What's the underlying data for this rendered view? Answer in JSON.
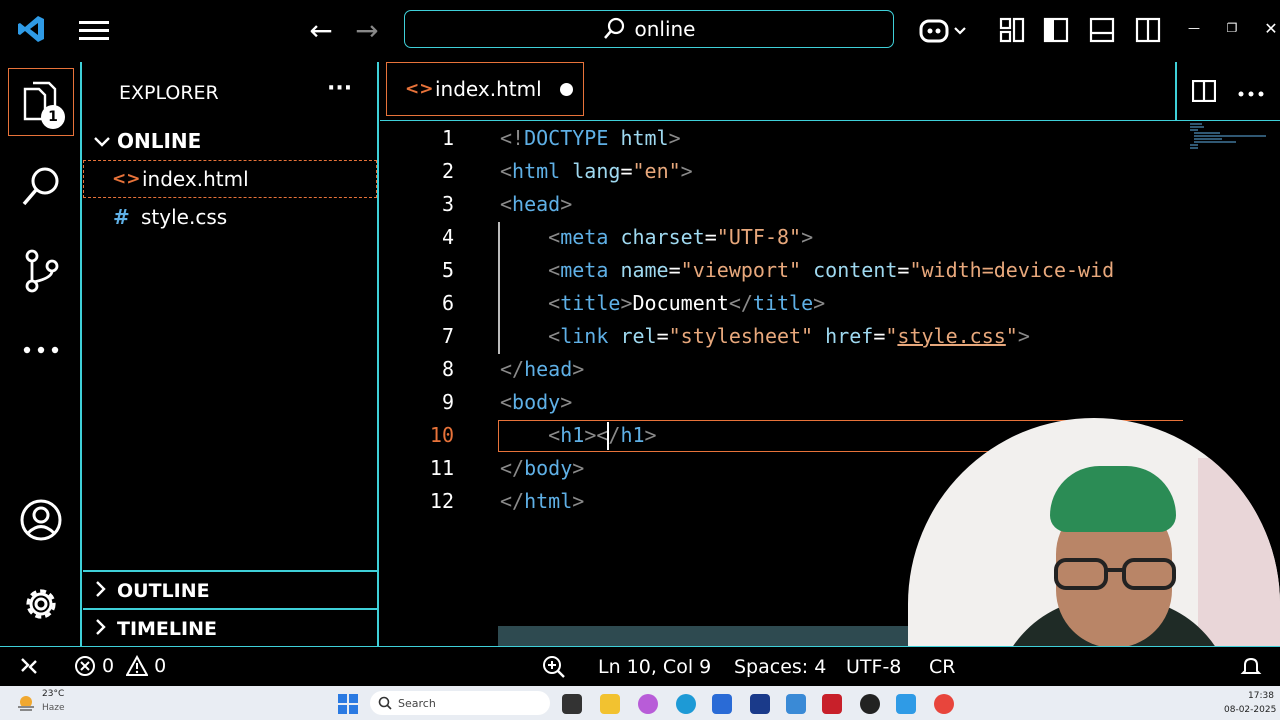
{
  "titlebar": {
    "search_text": "online",
    "nav_back": "←",
    "nav_forward": "→",
    "window_controls": [
      "—",
      "❐",
      "✕"
    ]
  },
  "activity_bar": {
    "explorer_badge": "1",
    "items": [
      "files-icon",
      "search-icon",
      "source-control-icon",
      "more-icon"
    ],
    "bottom_items": [
      "account-icon",
      "settings-icon"
    ]
  },
  "sidebar": {
    "title": "EXPLORER",
    "more": "···",
    "folder": "ONLINE",
    "files": [
      {
        "name": "index.html",
        "icon": "<>"
      },
      {
        "name": "style.css",
        "icon": "#"
      }
    ],
    "outline": "OUTLINE",
    "timeline": "TIMELINE"
  },
  "editor": {
    "tab_label": "index.html",
    "tab_icon": "<>",
    "line_numbers": [
      "1",
      "2",
      "3",
      "4",
      "5",
      "6",
      "7",
      "8",
      "9",
      "10",
      "11",
      "12"
    ],
    "lines": [
      "<!DOCTYPE html>",
      "<html lang=\"en\">",
      "<head>",
      "    <meta charset=\"UTF-8\">",
      "    <meta name=\"viewport\" content=\"width=device-wid",
      "    <title>Document</title>",
      "    <link rel=\"stylesheet\" href=\"style.css\">",
      "</head>",
      "<body>",
      "    <h1></h1>",
      "</body>",
      "</html>"
    ]
  },
  "statusbar": {
    "errors": "0",
    "warnings": "0",
    "position": "Ln 10, Col 9",
    "spaces": "Spaces: 4",
    "encoding": "UTF-8",
    "eol": "CR"
  },
  "taskbar": {
    "weather_temp": "23°C",
    "weather_desc": "Haze",
    "search": "Search",
    "time": "17:38",
    "date": "08-02-2025"
  },
  "colors": {
    "accent_border": "#3fd0d9",
    "active_tab_border": "#e8733a",
    "tag": "#5fb0e6",
    "string": "#e8a87c"
  }
}
